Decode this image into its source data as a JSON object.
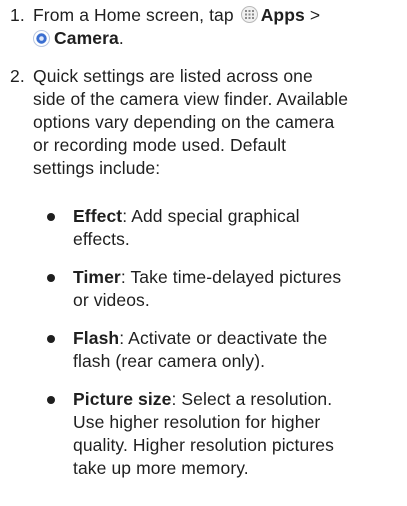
{
  "steps": [
    {
      "number": "1.",
      "text_before": "From a Home screen, tap",
      "apps_icon": "apps-grid-icon",
      "apps_label": "Apps",
      "separator": ">",
      "camera_icon": "camera-app-icon",
      "camera_label": "Camera",
      "end": "."
    },
    {
      "number": "2.",
      "lines": [
        "Quick settings are listed across one",
        "side of the camera view finder. Available",
        "options vary depending on the camera",
        "or recording mode used. Default",
        "settings include:"
      ]
    }
  ],
  "bullets": [
    {
      "term": "Effect",
      "first": ": Add special graphical",
      "rest": [
        "effects."
      ]
    },
    {
      "term": "Timer",
      "first": ": Take time-delayed pictures",
      "rest": [
        "or videos."
      ]
    },
    {
      "term": "Flash",
      "first": ": Activate or deactivate the",
      "rest": [
        "flash (rear camera only)."
      ]
    },
    {
      "term": "Picture size",
      "first": ": Select a resolution.",
      "rest": [
        "Use higher resolution for higher",
        "quality. Higher resolution pictures",
        "take up more memory."
      ]
    }
  ],
  "colors": {
    "text": "#1f1f1f",
    "camera_icon_blue": "#3b6fd1"
  }
}
